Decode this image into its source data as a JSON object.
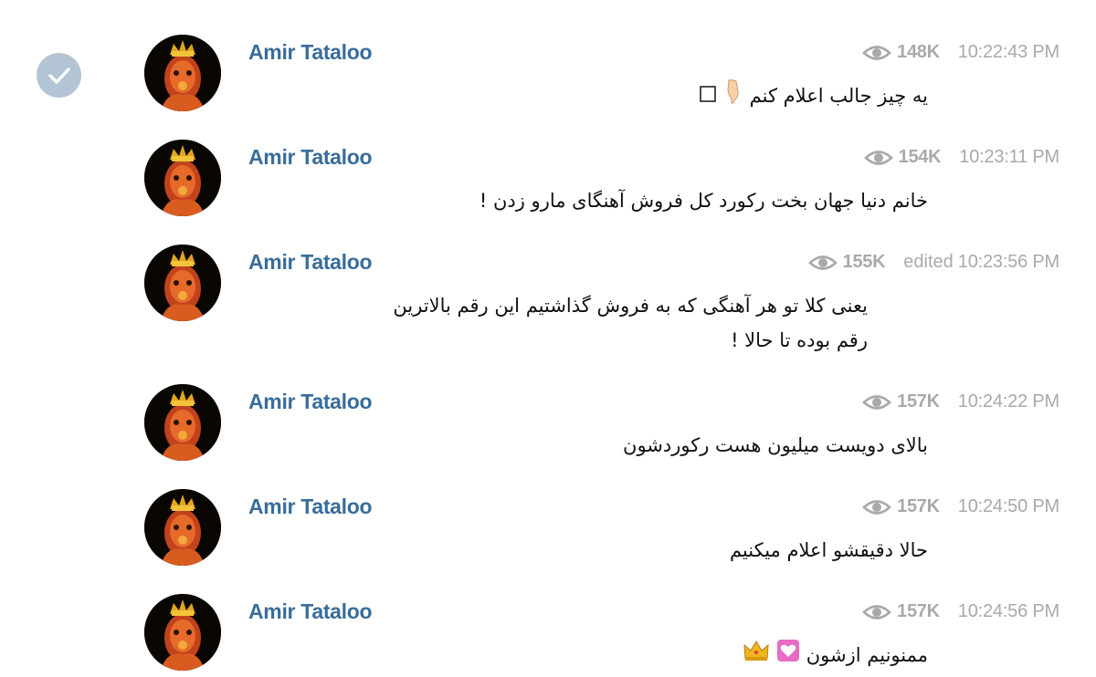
{
  "channel": {
    "selected": true
  },
  "messages": [
    {
      "author": "Amir Tataloo",
      "views": "148K",
      "edited": "",
      "time": "10:22:43 PM",
      "text": "یه چیز جالب اعلام کنم",
      "emoji": [
        "pointing-down-icon",
        "square-outline-icon"
      ]
    },
    {
      "author": "Amir Tataloo",
      "views": "154K",
      "edited": "",
      "time": "10:23:11 PM",
      "text": "خانم دنیا جهان بخت رکورد کل فروش آهنگای مارو زدن !",
      "emoji": []
    },
    {
      "author": "Amir Tataloo",
      "views": "155K",
      "edited": "edited",
      "time": "10:23:56 PM",
      "text_line1": "یعنی کلا تو هر آهنگی که به فروش گذاشتیم این رقم بالاترین",
      "text_line2": "رقم بوده تا حالا !",
      "emoji": []
    },
    {
      "author": "Amir Tataloo",
      "views": "157K",
      "edited": "",
      "time": "10:24:22 PM",
      "text": "بالای دویست میلیون هست رکوردشون",
      "emoji": []
    },
    {
      "author": "Amir Tataloo",
      "views": "157K",
      "edited": "",
      "time": "10:24:50 PM",
      "text": "حالا دقیقشو اعلام میکنیم",
      "emoji": []
    },
    {
      "author": "Amir Tataloo",
      "views": "157K",
      "edited": "",
      "time": "10:24:56 PM",
      "text": "ممنونیم ازشون",
      "emoji": [
        "heart-box-icon",
        "crown-icon"
      ]
    }
  ],
  "colors": {
    "author": "#3a6d99",
    "meta": "#a9a9a9",
    "check": "#b3c5d5",
    "text": "#111111"
  }
}
